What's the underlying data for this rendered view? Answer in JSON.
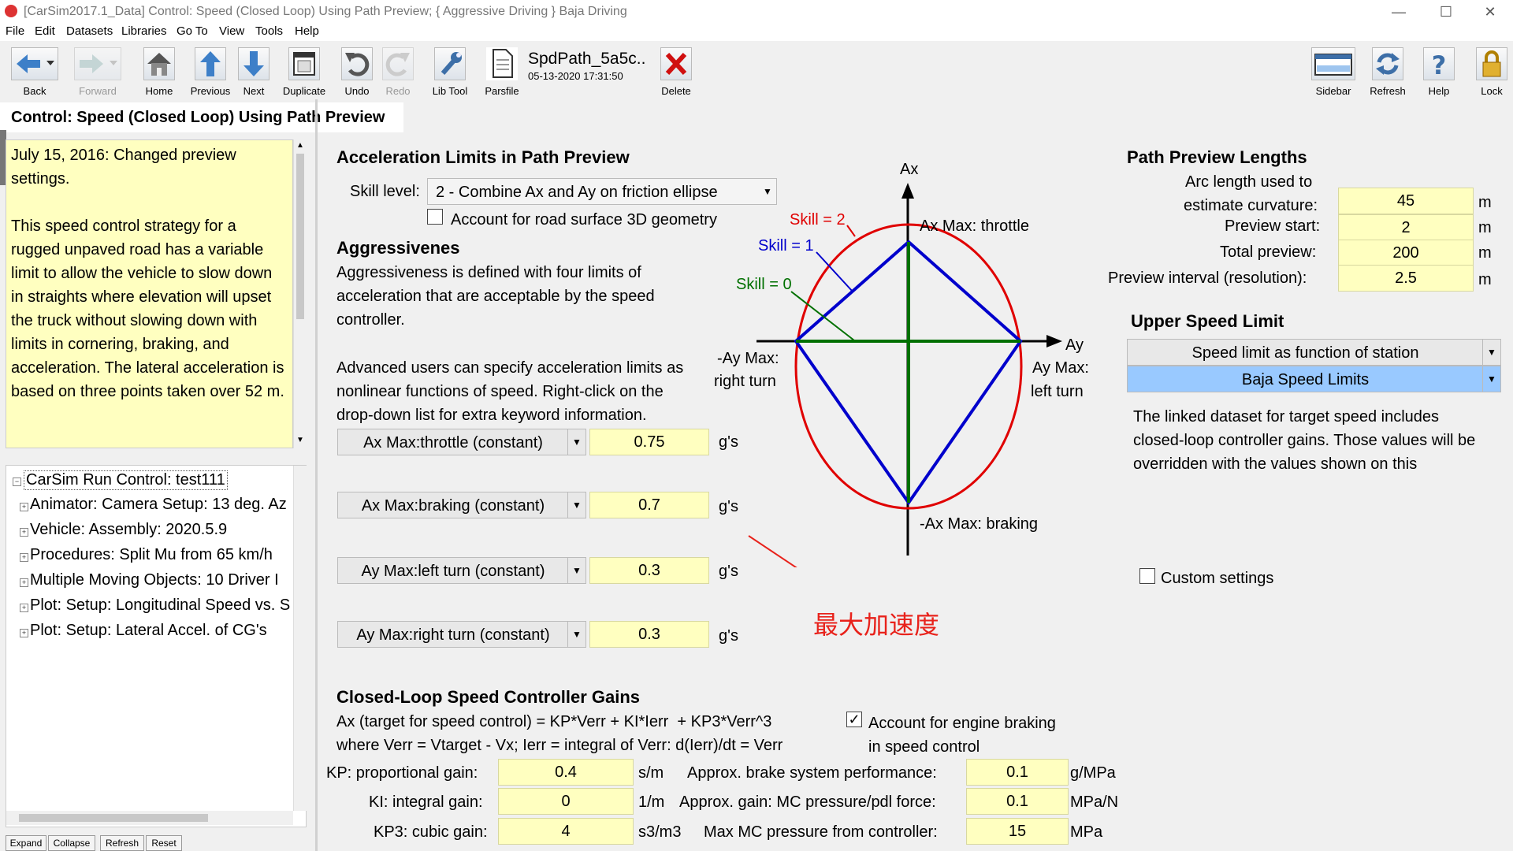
{
  "window": {
    "title": "[CarSim2017.1_Data] Control: Speed (Closed Loop) Using Path Preview; { Aggressive Driving } Baja Driving",
    "minimize": "—",
    "maximize": "☐",
    "close": "✕"
  },
  "menu": [
    "File",
    "Edit",
    "Datasets",
    "Libraries",
    "Go To",
    "View",
    "Tools",
    "Help"
  ],
  "toolbar": {
    "back": "Back",
    "forward": "Forward",
    "home": "Home",
    "previous": "Previous",
    "next": "Next",
    "duplicate": "Duplicate",
    "undo": "Undo",
    "redo": "Redo",
    "lib_tool": "Lib Tool",
    "parsfile": "Parsfile",
    "dataset_name": "SpdPath_5a5c..",
    "dataset_date": "05-13-2020 17:31:50",
    "delete": "Delete",
    "sidebar": "Sidebar",
    "refresh": "Refresh",
    "help": "Help",
    "lock": "Lock"
  },
  "left": {
    "tab_title": "Control: Speed (Closed Loop) Using Path Preview",
    "notes": [
      "July 15, 2016: Changed preview settings.",
      "This speed control strategy for a rugged unpaved road has a variable limit to allow the vehicle to slow down in straights where elevation will upset the truck without slowing down with limits in cornering, braking, and acceleration. The lateral acceleration is based on three points taken over 52 m."
    ],
    "tree": [
      "CarSim Run Control: test111",
      "Animator: Camera Setup: 13 deg. Az",
      "Vehicle: Assembly: 2020.5.9",
      "Procedures: Split Mu from 65 km/h",
      "Multiple Moving Objects: 10 Driver I",
      "Plot: Setup: Longitudinal Speed vs. S",
      "Plot: Setup: Lateral Accel. of CG's"
    ],
    "buttons": {
      "expand": "Expand",
      "collapse": "Collapse",
      "refresh": "Refresh",
      "reset": "Reset"
    }
  },
  "accel": {
    "heading": "Acceleration Limits in Path Preview",
    "skill_label": "Skill level:",
    "skill_value": "2 - Combine Ax and Ay on friction ellipse",
    "road3d_label": "Account for road surface 3D geometry",
    "aggr_heading": "Aggressivenes",
    "aggr_text1": [
      "Aggressiveness is defined with four limits of",
      "acceleration that are acceptable by the speed",
      "controller."
    ],
    "aggr_text2": [
      "Advanced users can specify acceleration limits as",
      "nonlinear functions of speed. Right-click on the",
      "drop-down list for extra keyword information."
    ],
    "limits": [
      {
        "label": "Ax Max:throttle (constant)",
        "value": "0.75",
        "unit": "g's"
      },
      {
        "label": "Ax Max:braking (constant)",
        "value": "0.7",
        "unit": "g's"
      },
      {
        "label": "Ay Max:left turn (constant)",
        "value": "0.3",
        "unit": "g's"
      },
      {
        "label": "Ay Max:right turn (constant)",
        "value": "0.3",
        "unit": "g's"
      }
    ]
  },
  "diagram": {
    "ax": "Ax",
    "ay": "Ay",
    "skill2": "Skill = 2",
    "skill1": "Skill = 1",
    "skill0": "Skill = 0",
    "throttle": "Ax Max: throttle",
    "braking": "-Ax Max: braking",
    "right_turn_1": "-Ay Max:",
    "right_turn_2": "right turn",
    "left_turn_1": "Ay Max:",
    "left_turn_2": "left turn",
    "color_skill2": "#e00000",
    "color_skill1": "#0000cc",
    "color_skill0": "#007000",
    "annotation": "最大加速度",
    "annotation_color": "#e8221b"
  },
  "preview": {
    "heading": "Path Preview Lengths",
    "rows": [
      {
        "label1": "Arc length used to",
        "label2": "estimate curvature:",
        "value": "45",
        "unit": "m"
      },
      {
        "label1": "Preview start:",
        "value": "2",
        "unit": "m"
      },
      {
        "label1": "Total preview:",
        "value": "200",
        "unit": "m"
      },
      {
        "label1": "Preview interval (resolution):",
        "value": "2.5",
        "unit": "m"
      }
    ]
  },
  "upper": {
    "heading": "Upper Speed Limit",
    "mode": "Speed limit as function of station",
    "dataset": "Baja Speed Limits",
    "note": [
      "The linked dataset for target speed includes",
      "closed-loop controller gains. Those values will be",
      "overridden with the values shown on this"
    ],
    "custom_label": "Custom settings"
  },
  "gains": {
    "heading": "Closed-Loop Speed Controller Gains",
    "eq1": "Ax (target for speed control) = KP*Verr + KI*Ierr  + KP3*Verr^3",
    "eq2": "where Verr = Vtarget - Vx; Ierr = integral of Verr: d(Ierr)/dt = Verr",
    "engine_label1": "Account for engine braking",
    "engine_label2": "in speed control",
    "engine_checked": "✓",
    "left": [
      {
        "label": "KP: proportional gain:",
        "value": "0.4",
        "unit": "s/m"
      },
      {
        "label": "KI: integral gain:",
        "value": "0",
        "unit": "1/m"
      },
      {
        "label": "KP3: cubic gain:",
        "value": "4",
        "unit": "s3/m3"
      }
    ],
    "right": [
      {
        "label": "Approx. brake system performance:",
        "value": "0.1",
        "unit": "g/MPa"
      },
      {
        "label": "Approx. gain: MC pressure/pdl force:",
        "value": "0.1",
        "unit": "MPa/N"
      },
      {
        "label": "Max MC pressure from controller:",
        "value": "15",
        "unit": "MPa"
      }
    ]
  }
}
